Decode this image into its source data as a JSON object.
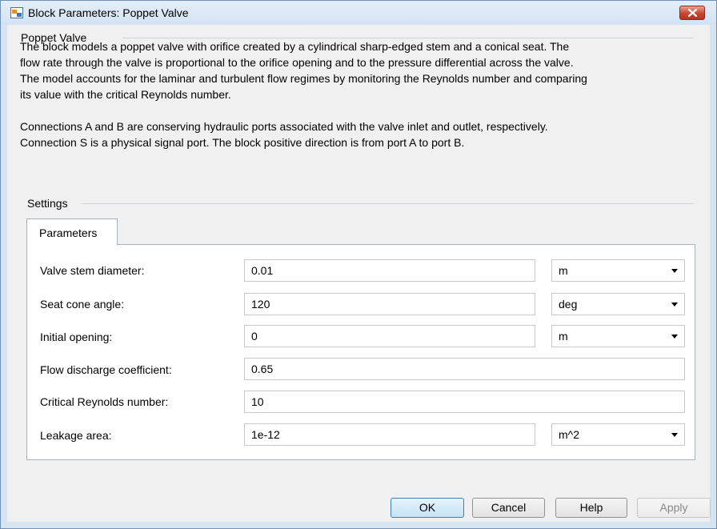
{
  "window": {
    "title": "Block Parameters: Poppet Valve",
    "app_icon": "simulink-block-icon",
    "close_icon": "close-icon"
  },
  "block_group": {
    "label": "Poppet Valve",
    "description_para1": [
      "The block models a poppet valve with orifice created by a cylindrical sharp-edged stem and a conical seat. The",
      "flow rate through the valve is proportional to the orifice opening and to the pressure differential across the valve.",
      "The model accounts for the laminar and turbulent flow regimes by monitoring the Reynolds number and comparing",
      "its value with the critical Reynolds number."
    ],
    "description_para2": [
      "Connections A and B are conserving hydraulic ports associated with the valve inlet and outlet, respectively.",
      "Connection S is a physical signal port. The block positive direction is from port A to port B."
    ]
  },
  "settings": {
    "label": "Settings",
    "tabs": [
      {
        "label": "Parameters",
        "selected": true
      }
    ],
    "params": [
      {
        "label": "Valve stem diameter:",
        "value": "0.01",
        "unit": "m"
      },
      {
        "label": "Seat cone angle:",
        "value": "120",
        "unit": "deg"
      },
      {
        "label": "Initial opening:",
        "value": "0",
        "unit": "m"
      },
      {
        "label": "Flow discharge coefficient:",
        "value": "0.65",
        "unit": null
      },
      {
        "label": "Critical Reynolds number:",
        "value": "10",
        "unit": null
      },
      {
        "label": "Leakage area:",
        "value": "1e-12",
        "unit": "m^2"
      }
    ]
  },
  "buttons": {
    "ok": "OK",
    "cancel": "Cancel",
    "help": "Help",
    "apply": "Apply"
  },
  "colors": {
    "accent": "#3c7fb1",
    "close_button": "#c9462f",
    "window_frame": "#d7e4f2"
  }
}
